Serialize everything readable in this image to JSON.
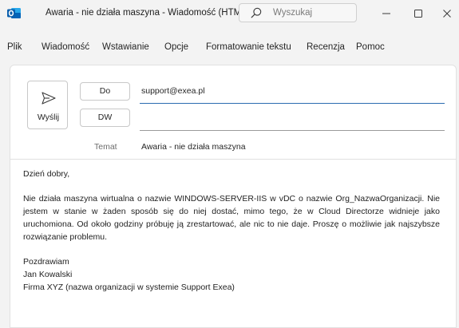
{
  "window": {
    "title": "Awaria - nie działa maszyna  -  Wiadomość (HTML)",
    "search_placeholder": "Wyszukaj",
    "colors": {
      "accent": "#0f6cbd",
      "to_underline": "#2b6cb0"
    }
  },
  "ribbon": {
    "items": [
      "Plik",
      "Wiadomość",
      "Wstawianie",
      "Opcje",
      "Formatowanie tekstu",
      "Recenzja",
      "Pomoc"
    ]
  },
  "compose": {
    "send_label": "Wyślij",
    "to_label": "Do",
    "cc_label": "DW",
    "to_value": "support@exea.pl",
    "subject_label": "Temat",
    "subject_value": "Awaria - nie działa maszyna"
  },
  "body": {
    "greeting": "Dzień dobry,",
    "paragraph": "Nie działa maszyna wirtualna o nazwie WINDOWS-SERVER-IIS w vDC o nazwie Org_NazwaOrganizacji. Nie jestem w stanie w żaden sposób się do niej dostać, mimo tego, że w Cloud Directorze widnieje jako uruchomiona. Od około godziny próbuję ją zrestartować, ale nic to nie daje. Proszę o możliwie jak najszybsze rozwiązanie problemu.",
    "closing": "Pozdrawiam",
    "name": "Jan Kowalski",
    "company": "Firma XYZ (nazwa organizacji w systemie Support Exea)"
  }
}
